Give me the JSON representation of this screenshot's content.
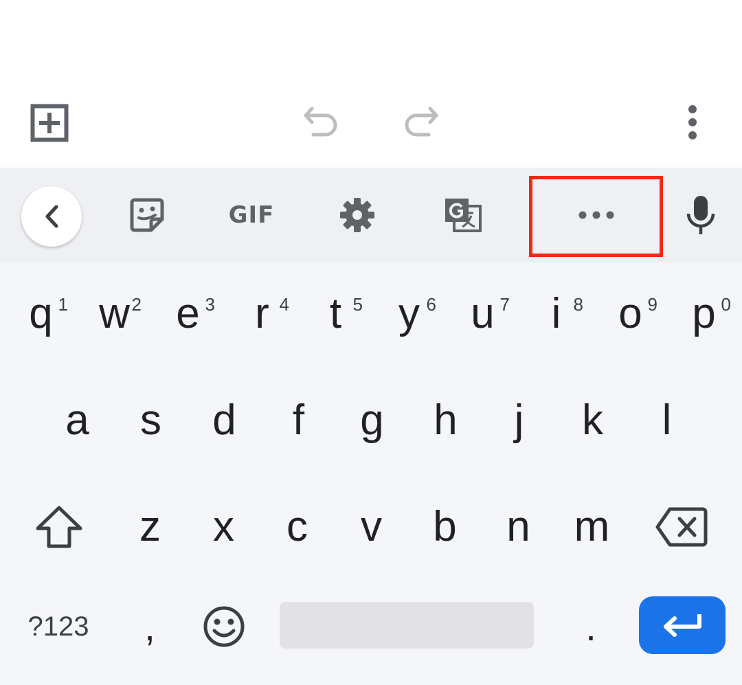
{
  "toolbar": {
    "add_icon": "add-box-icon",
    "undo_icon": "undo-icon",
    "redo_icon": "redo-icon",
    "more_icon": "more-vert-icon"
  },
  "strip": {
    "back_icon": "chevron-left-icon",
    "sticker_icon": "sticker-icon",
    "gif_label": "GIF",
    "settings_icon": "gear-icon",
    "translate_icon": "translate-icon",
    "more_icon": "more-horiz-icon",
    "mic_icon": "mic-icon",
    "highlight_color": "#ef2b10"
  },
  "keyboard": {
    "row1": [
      {
        "ch": "q",
        "hint": "1"
      },
      {
        "ch": "w",
        "hint": "2"
      },
      {
        "ch": "e",
        "hint": "3"
      },
      {
        "ch": "r",
        "hint": "4"
      },
      {
        "ch": "t",
        "hint": "5"
      },
      {
        "ch": "y",
        "hint": "6"
      },
      {
        "ch": "u",
        "hint": "7"
      },
      {
        "ch": "i",
        "hint": "8"
      },
      {
        "ch": "o",
        "hint": "9"
      },
      {
        "ch": "p",
        "hint": "0"
      }
    ],
    "row2": [
      "a",
      "s",
      "d",
      "f",
      "g",
      "h",
      "j",
      "k",
      "l"
    ],
    "row3": [
      "z",
      "x",
      "c",
      "v",
      "b",
      "n",
      "m"
    ],
    "symbols_label": "?123",
    "comma": ",",
    "period": ".",
    "shift_icon": "shift-icon",
    "backspace_icon": "backspace-icon",
    "emoji_icon": "emoji-icon",
    "enter_icon": "enter-icon",
    "enter_color": "#1a73e8"
  }
}
